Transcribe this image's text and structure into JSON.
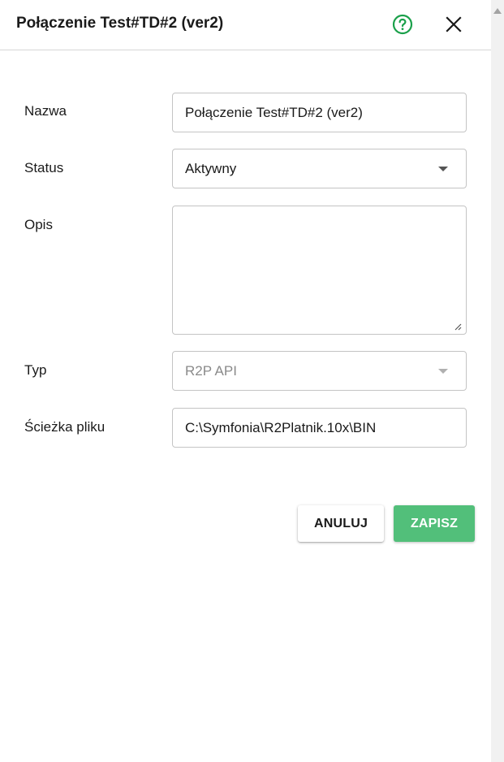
{
  "dialog": {
    "title": "Połączenie Test#TD#2 (ver2)",
    "help_icon": "help-circle-icon",
    "close_icon": "close-icon"
  },
  "form": {
    "name": {
      "label": "Nazwa",
      "value": "Połączenie Test#TD#2 (ver2)"
    },
    "status": {
      "label": "Status",
      "value": "Aktywny"
    },
    "description": {
      "label": "Opis",
      "value": ""
    },
    "type": {
      "label": "Typ",
      "value": "R2P API",
      "disabled": true
    },
    "file_path": {
      "label": "Ścieżka pliku",
      "value": "C:\\Symfonia\\R2Platnik.10x\\BIN"
    }
  },
  "actions": {
    "cancel_label": "ANULUJ",
    "save_label": "ZAPISZ"
  },
  "colors": {
    "accent": "#52bf7a",
    "help_icon": "#1aa04a"
  }
}
